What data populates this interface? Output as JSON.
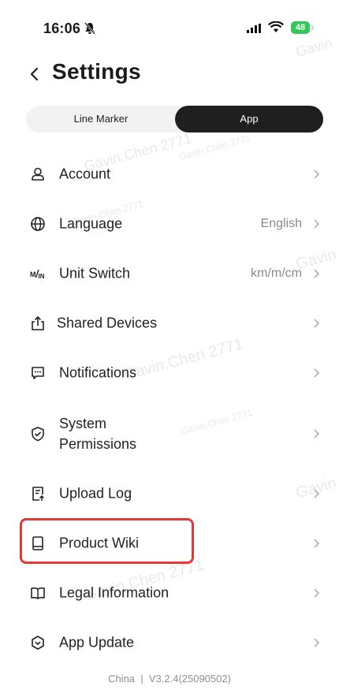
{
  "status": {
    "time": "16:06",
    "battery": "48"
  },
  "header": {
    "title": "Settings"
  },
  "segments": {
    "left": "Line Marker",
    "right": "App"
  },
  "menu": [
    {
      "label": "Account",
      "value": ""
    },
    {
      "label": "Language",
      "value": "English"
    },
    {
      "label": "Unit Switch",
      "value": "km/m/cm"
    },
    {
      "label": "Shared Devices",
      "value": ""
    },
    {
      "label": "Notifications",
      "value": ""
    },
    {
      "label": "System Permissions",
      "value": ""
    },
    {
      "label": "Upload Log",
      "value": ""
    },
    {
      "label": "Product Wiki",
      "value": ""
    },
    {
      "label": "Legal Information",
      "value": ""
    },
    {
      "label": "App Update",
      "value": ""
    }
  ],
  "footer": {
    "text": "China  |  V3.2.4(25090502)"
  },
  "watermark": {
    "text_a": "Gavin.Chen 2771",
    "text_b": "Gavin"
  },
  "colors": {
    "highlight": "#e53935",
    "battery": "#34c759",
    "active_tab": "#1f1f1f"
  }
}
